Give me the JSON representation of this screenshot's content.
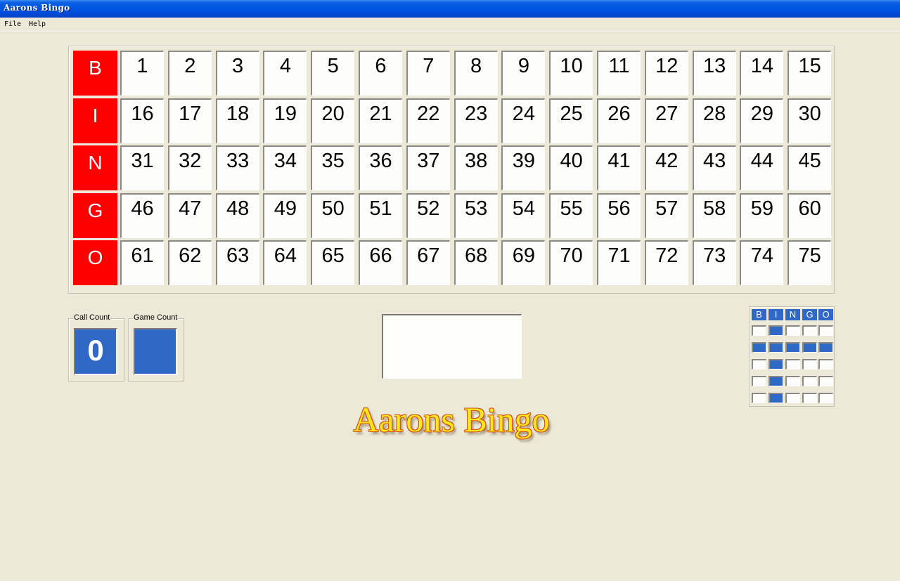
{
  "window": {
    "title": "Aarons Bingo"
  },
  "menu": [
    {
      "label": "File"
    },
    {
      "label": "Help"
    }
  ],
  "board": {
    "letters": [
      "B",
      "I",
      "N",
      "G",
      "O"
    ],
    "rows": [
      [
        1,
        2,
        3,
        4,
        5,
        6,
        7,
        8,
        9,
        10,
        11,
        12,
        13,
        14,
        15
      ],
      [
        16,
        17,
        18,
        19,
        20,
        21,
        22,
        23,
        24,
        25,
        26,
        27,
        28,
        29,
        30
      ],
      [
        31,
        32,
        33,
        34,
        35,
        36,
        37,
        38,
        39,
        40,
        41,
        42,
        43,
        44,
        45
      ],
      [
        46,
        47,
        48,
        49,
        50,
        51,
        52,
        53,
        54,
        55,
        56,
        57,
        58,
        59,
        60
      ],
      [
        61,
        62,
        63,
        64,
        65,
        66,
        67,
        68,
        69,
        70,
        71,
        72,
        73,
        74,
        75
      ]
    ],
    "letter_color": "#ff0000"
  },
  "call_count": {
    "label": "Call Count",
    "value": "0"
  },
  "game_count": {
    "label": "Game Count",
    "value": ""
  },
  "current_call": {
    "value": ""
  },
  "logo": {
    "text": "Aarons Bingo"
  },
  "pattern": {
    "headers": [
      "B",
      "I",
      "N",
      "G",
      "O"
    ],
    "grid": [
      [
        0,
        1,
        0,
        0,
        0
      ],
      [
        1,
        1,
        1,
        1,
        1
      ],
      [
        0,
        1,
        0,
        0,
        0
      ],
      [
        0,
        1,
        0,
        0,
        0
      ],
      [
        0,
        1,
        0,
        0,
        0
      ]
    ],
    "on_color": "#3068c8"
  }
}
